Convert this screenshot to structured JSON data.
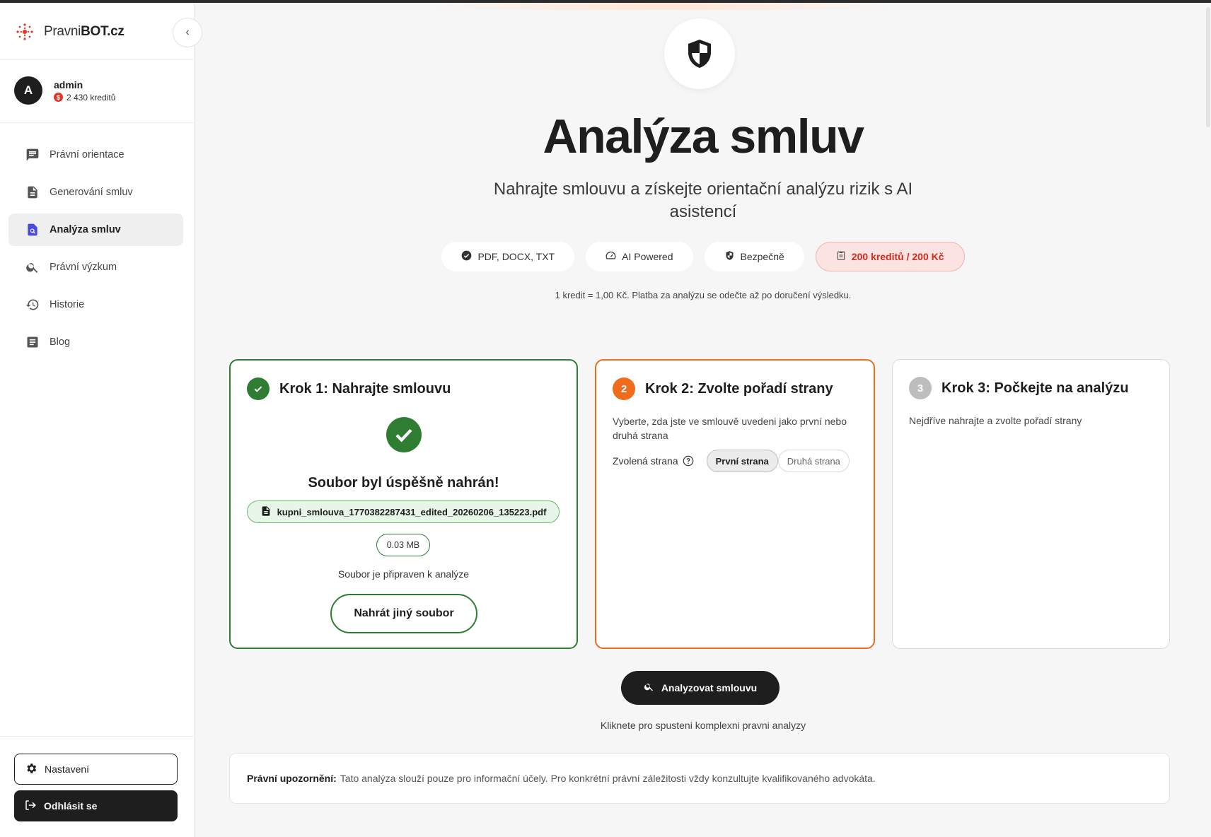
{
  "app": {
    "brand_prefix": "Pravni",
    "brand_suffix": "BOT.cz"
  },
  "user": {
    "avatar_letter": "A",
    "name": "admin",
    "credits": "2 430 kreditů"
  },
  "nav": {
    "items": [
      {
        "label": "Právní orientace",
        "icon": "chat-icon"
      },
      {
        "label": "Generování smluv",
        "icon": "document-icon"
      },
      {
        "label": "Analýza smluv",
        "icon": "document-search-icon",
        "active": true
      },
      {
        "label": "Právní výzkum",
        "icon": "search-icon"
      },
      {
        "label": "Historie",
        "icon": "history-icon"
      },
      {
        "label": "Blog",
        "icon": "article-icon"
      }
    ]
  },
  "sidebar_bottom": {
    "settings": "Nastavení",
    "logout": "Odhlásit se"
  },
  "hero": {
    "title": "Analýza smluv",
    "subtitle": "Nahrajte smlouvu a získejte orientační analýzu rizik s AI asistencí",
    "chips": [
      "PDF, DOCX, TXT",
      "AI Powered",
      "Bezpečně",
      "200 kreditů / 200 Kč"
    ],
    "note": "1 kredit = 1,00 Kč. Platba za analýzu se odečte až po doručení výsledku."
  },
  "step1": {
    "badge": "✓",
    "title": "Krok 1: Nahrajte smlouvu",
    "success": "Soubor byl úspěšně nahrán!",
    "filename": "kupni_smlouva_1770382287431_edited_20260206_135223.pdf",
    "size": "0.03 MB",
    "ready": "Soubor je připraven k analýze",
    "reupload": "Nahrát jiný soubor"
  },
  "step2": {
    "badge": "2",
    "title": "Krok 2: Zvolte pořadí strany",
    "desc": "Vyberte, zda jste ve smlouvě uvedeni jako první nebo druhá strana",
    "label": "Zvolená strana",
    "options": [
      "První strana",
      "Druhá strana"
    ],
    "selected": "První strana"
  },
  "step3": {
    "badge": "3",
    "title": "Krok 3: Počkejte na analýzu",
    "desc": "Nejdříve nahrajte a zvolte pořadí strany"
  },
  "actions": {
    "analyze": "Analyzovat smlouvu",
    "hint": "Kliknete pro spusteni komplexni pravni analyzy"
  },
  "disclaimer": {
    "label": "Právní upozornění:",
    "text": "Tato analýza slouží pouze pro informační účely. Pro konkrétní právní záležitosti vždy konzultujte kvalifikovaného advokáta."
  },
  "colors": {
    "success": "#2e7d32",
    "accent": "#ef6c1a",
    "brand_red": "#e5352b",
    "dark": "#1e1e1e"
  }
}
